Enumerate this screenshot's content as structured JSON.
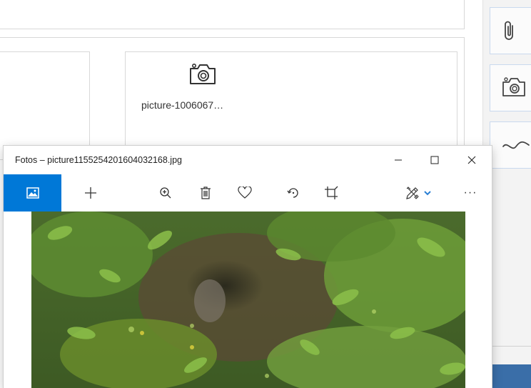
{
  "background": {
    "tile": {
      "filename": "picture-1006067…",
      "icon": "camera-icon"
    },
    "side_buttons": [
      {
        "icon": "paperclip-icon"
      },
      {
        "icon": "camera-icon"
      },
      {
        "icon": "scribble-icon"
      }
    ]
  },
  "window": {
    "title": "Fotos – picture1155254201604032168.jpg",
    "controls": {
      "minimize": "–",
      "maximize": "☐",
      "close": "✕"
    }
  },
  "toolbar": {
    "items": [
      {
        "icon": "picture-icon",
        "active": true
      },
      {
        "icon": "plus-icon"
      },
      {
        "icon": "zoom-in-icon"
      },
      {
        "icon": "trash-icon"
      },
      {
        "icon": "heart-icon"
      },
      {
        "icon": "rotate-icon"
      },
      {
        "icon": "crop-icon"
      },
      {
        "icon": "edit-draw-icon"
      },
      {
        "icon": "chevron-down-icon"
      },
      {
        "icon": "more-icon",
        "label": "···"
      }
    ]
  },
  "photo": {
    "subject": "forest-undergrowth"
  },
  "colors": {
    "accent": "#0078d7",
    "chevron": "#2a7fd4",
    "taskbar": "#3a6ea8"
  }
}
